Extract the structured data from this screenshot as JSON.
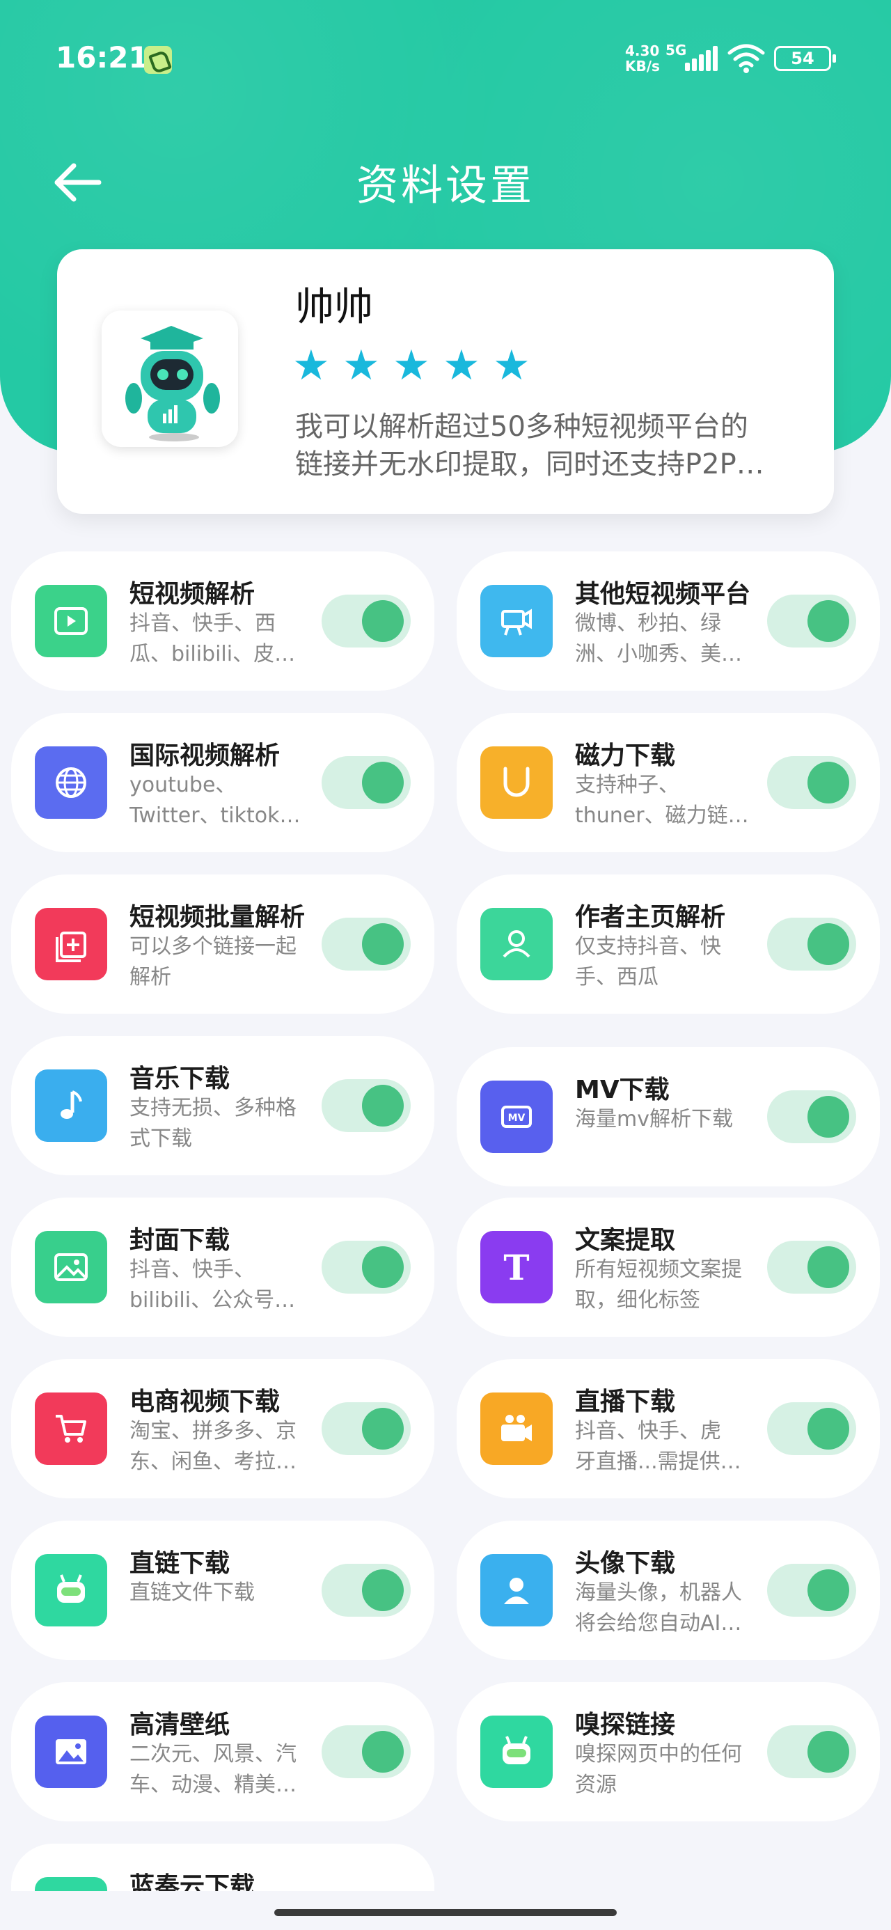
{
  "status_bar": {
    "time": "16:21",
    "net_speed_value": "4.30",
    "net_speed_unit": "KB/s",
    "network_type": "5G",
    "battery": "54"
  },
  "header": {
    "title": "资料设置",
    "back_icon": "arrow-left-icon",
    "background_color": "#24c9a4"
  },
  "profile": {
    "name": "帅帅",
    "rating": 5,
    "description_line1": "我可以解析超过50多种短视频平台的",
    "description_line2": "链接并无水印提取，同时还支持P2P…",
    "star_color": "#19b8dc"
  },
  "features": [
    {
      "title": "短视频解析",
      "desc1": "抖音、快手、西",
      "desc2": "瓜、bilibili、皮…",
      "icon": "video-play-icon",
      "color": "#3bd28a",
      "enabled": true
    },
    {
      "title": "其他短视频平台",
      "desc1": "微博、秒拍、绿",
      "desc2": "洲、小咖秀、美…",
      "icon": "camera-icon",
      "color": "#3fb8ee",
      "enabled": true
    },
    {
      "title": "国际视频解析",
      "desc1": "youtube、",
      "desc2": "Twitter、tiktok…",
      "icon": "globe-icon",
      "color": "#5b6cf0",
      "enabled": true
    },
    {
      "title": "磁力下载",
      "desc1": "支持种子、",
      "desc2": "thuner、磁力链…",
      "icon": "magnet-icon",
      "color": "#f7b02a",
      "enabled": true
    },
    {
      "title": "短视频批量解析",
      "desc1": "可以多个链接一起",
      "desc2": "解析",
      "icon": "batch-add-icon",
      "color": "#f23a5a",
      "enabled": true
    },
    {
      "title": "作者主页解析",
      "desc1": "仅支持抖音、快",
      "desc2": "手、西瓜",
      "icon": "user-icon",
      "color": "#3cd69a",
      "enabled": true
    },
    {
      "title": "音乐下载",
      "desc1": "支持无损、多种格",
      "desc2": "式下载",
      "icon": "music-note-icon",
      "color": "#3aaeee",
      "enabled": true
    },
    {
      "title": "MV下载",
      "desc1": "海量mv解析下载",
      "desc2": "",
      "icon": "mv-icon",
      "color": "#5860ee",
      "enabled": true
    },
    {
      "title": "封面下载",
      "desc1": "抖音、快手、",
      "desc2": "bilibili、公众号…",
      "icon": "image-icon",
      "color": "#38cf8c",
      "enabled": true
    },
    {
      "title": "文案提取",
      "desc1": "所有短视频文案提",
      "desc2": "取，细化标签",
      "icon": "text-t-icon",
      "color": "#8a3cf0",
      "enabled": true
    },
    {
      "title": "电商视频下载",
      "desc1": "淘宝、拼多多、京",
      "desc2": "东、闲鱼、考拉…",
      "icon": "shopping-cart-icon",
      "color": "#f23a5a",
      "enabled": true
    },
    {
      "title": "直播下载",
      "desc1": "抖音、快手、虎",
      "desc2": "牙直播...需提供…",
      "icon": "live-camera-icon",
      "color": "#f8a825",
      "enabled": true
    },
    {
      "title": "直链下载",
      "desc1": "直链文件下载",
      "desc2": "",
      "icon": "robot-icon",
      "color": "#2fd8a0",
      "enabled": true
    },
    {
      "title": "头像下载",
      "desc1": "海量头像，机器人",
      "desc2": "将会给您自动AI…",
      "icon": "avatar-icon",
      "color": "#3ab0ee",
      "enabled": true
    },
    {
      "title": "高清壁纸",
      "desc1": "二次元、风景、汽",
      "desc2": "车、动漫、精美…",
      "icon": "wallpaper-icon",
      "color": "#5560ee",
      "enabled": true
    },
    {
      "title": "嗅探链接",
      "desc1": "嗅探网页中的任何",
      "desc2": "资源",
      "icon": "robot-icon",
      "color": "#2fd8a0",
      "enabled": true
    },
    {
      "title": "蓝奏云下载",
      "desc1": "",
      "desc2": "",
      "icon": "cloud-icon",
      "color": "#2fd8a0",
      "enabled": true
    }
  ]
}
